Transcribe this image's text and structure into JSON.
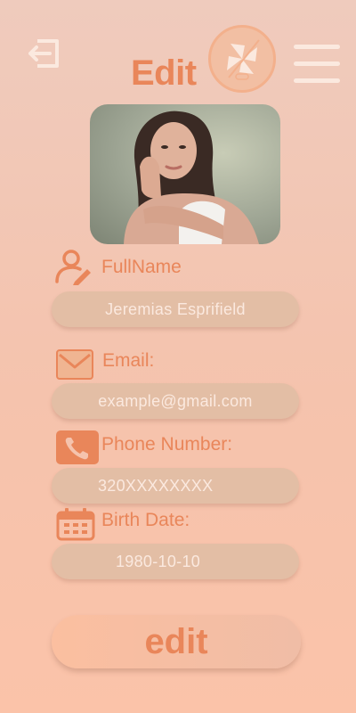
{
  "header": {
    "title": "Edit"
  },
  "profile": {
    "fields": [
      {
        "label": "FullName",
        "value": "Jeremias Esprifield",
        "icon": "user-edit-icon"
      },
      {
        "label": "Email:",
        "value": "example@gmail.com",
        "icon": "mail-icon"
      },
      {
        "label": "Phone Number:",
        "value": "320XXXXXXXX",
        "icon": "phone-icon"
      },
      {
        "label": "Birth Date:",
        "value": "1980-10-10",
        "icon": "calendar-icon"
      }
    ]
  },
  "actions": {
    "edit_label": "edit"
  },
  "colors": {
    "accent": "#e9865a",
    "field_bg": "#e3bea5",
    "field_text": "#fbe9df",
    "background_top": "#efcbbd",
    "background_bottom": "#fbc3a9"
  }
}
